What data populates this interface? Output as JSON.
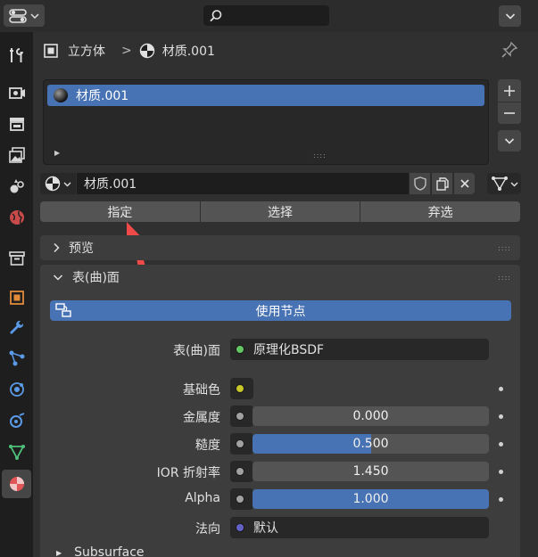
{
  "header": {
    "editor_type_icon": "properties-editor-icon",
    "search_icon": "search-icon",
    "menu_icon": "chevron-down-icon"
  },
  "tabs": [
    {
      "name": "tool-tab",
      "icon": "wrench-screwdriver-icon"
    },
    {
      "name": "render-tab",
      "icon": "camera-back-icon"
    },
    {
      "name": "output-tab",
      "icon": "printer-icon"
    },
    {
      "name": "view-layer-tab",
      "icon": "image-stack-icon"
    },
    {
      "name": "scene-tab",
      "icon": "scene-icon"
    },
    {
      "name": "world-tab",
      "icon": "globe-icon"
    },
    {
      "name": "collection-tab",
      "icon": "box-icon"
    },
    {
      "name": "object-tab",
      "icon": "object-square-icon"
    },
    {
      "name": "modifier-tab",
      "icon": "wrench-icon"
    },
    {
      "name": "particles-tab",
      "icon": "particles-icon"
    },
    {
      "name": "physics-tab",
      "icon": "physics-orbit-icon"
    },
    {
      "name": "constraints-tab",
      "icon": "constraint-icon"
    },
    {
      "name": "data-tab",
      "icon": "triangle-mesh-icon"
    },
    {
      "name": "material-tab",
      "icon": "material-sphere-icon",
      "active": true
    }
  ],
  "breadcrumb": {
    "object": "立方体",
    "separator": ">",
    "material": "材质.001"
  },
  "slot_list": {
    "items": [
      "材质.001"
    ],
    "selected": 0
  },
  "material_selector": {
    "name": "材质.001"
  },
  "assign_row": {
    "assign": "指定",
    "select": "选择",
    "deselect": "弃选"
  },
  "panels": {
    "preview": "预览",
    "surface": "表(曲)面"
  },
  "surface": {
    "use_nodes": "使用节点",
    "surface_label": "表(曲)面",
    "surface_value": "原理化BSDF",
    "base_color_label": "基础色",
    "base_color": "#ffffff",
    "metallic_label": "金属度",
    "metallic_value": "0.000",
    "metallic_fill": 0.0,
    "roughness_label": "糙度",
    "roughness_value": "0.500",
    "roughness_fill": 0.5,
    "ior_label": "IOR 折射率",
    "ior_value": "1.450",
    "ior_fill": 0.0,
    "alpha_label": "Alpha",
    "alpha_value": "1.000",
    "alpha_fill": 1.0,
    "normal_label": "法向",
    "normal_value": "默认",
    "subsurface": "Subsurface"
  },
  "colors": {
    "accent": "#4772b3",
    "socket_shader": "#63c763",
    "socket_color": "#c7c729",
    "socket_float": "#a1a1a1",
    "socket_vector": "#6363c7",
    "annotation_arrow": "#f04a48"
  }
}
